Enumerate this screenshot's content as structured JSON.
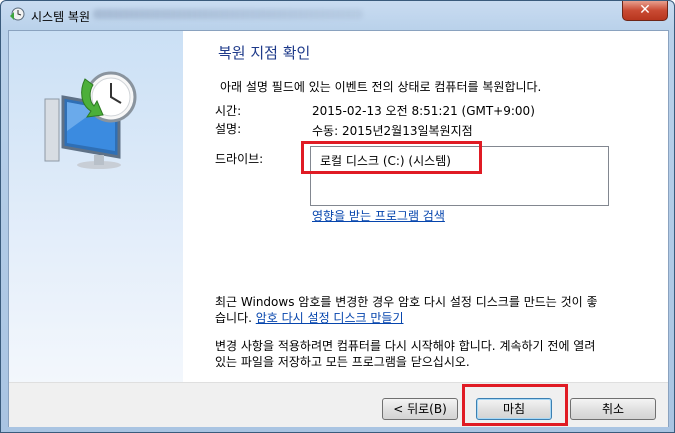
{
  "window": {
    "title": "시스템 복원",
    "close_label": "✕"
  },
  "main": {
    "heading": "복원 지점 확인",
    "description": "아래 설명 필드에 있는 이벤트 전의 상태로 컴퓨터를 복원합니다.",
    "time_label": "시간:",
    "time_value": "2015-02-13 오전 8:51:21 (GMT+9:00)",
    "desc_label": "설명:",
    "desc_value": "수동: 2015년2월13일복원지점",
    "drive_label": "드라이브:",
    "drives": [
      "로컬 디스크 (C:) (시스템)"
    ],
    "affected_link": "영향을 받는 프로그램 검색",
    "password_note": "최근 Windows 암호를 변경한 경우 암호 다시 설정 디스크를 만드는 것이 좋",
    "password_note2": "습니다. ",
    "password_link": "암호 다시 설정 디스크 만들기",
    "restart_note1": "변경 사항을 적용하려면 컴퓨터를 다시 시작해야 합니다. 계속하기 전에 열려",
    "restart_note2": "있는 파일을 저장하고 모든 프로그램을 닫으십시오."
  },
  "footer": {
    "back_label": "< 뒤로(B)",
    "finish_label": "마침",
    "cancel_label": "취소"
  },
  "colors": {
    "highlight": "#e01b24",
    "link": "#0645ad",
    "heading": "#1e3a8a"
  }
}
